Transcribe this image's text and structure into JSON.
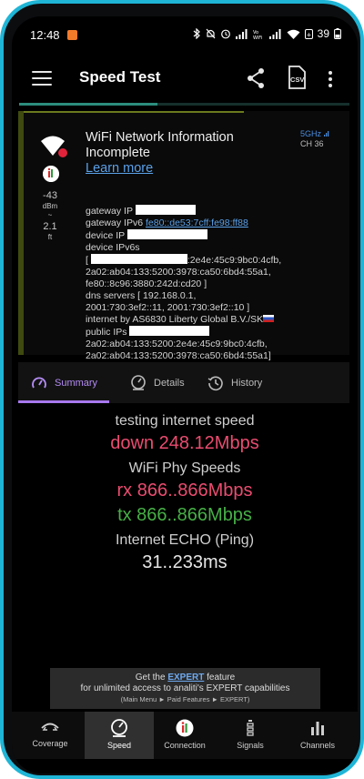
{
  "status_bar": {
    "time": "12:48",
    "battery": "39"
  },
  "app_bar": {
    "title": "Speed Test",
    "csv_label": "CSV"
  },
  "progress": {
    "value_percent": 42
  },
  "network": {
    "title": "WiFi Network Information Incomplete",
    "learn_more": "Learn more",
    "band": "5GHz",
    "channel": "CH 36",
    "rssi": "-43",
    "rssi_unit": "dBm",
    "approx": "~",
    "distance": "2.1",
    "distance_unit": "ft",
    "gateway_ip_label": "gateway IP",
    "gateway_ipv6_label": "gateway IPv6",
    "gateway_ipv6_value": "fe80::de53:7cff:fe98:ff88",
    "device_ip_label": "device IP",
    "device_ipv6s_label": "device IPv6s",
    "ipv6_line1": ":2e4e:45c9:9bc0:4cfb,",
    "ipv6_line2": "2a02:ab04:133:5200:3978:ca50:6bd4:55a1,",
    "ipv6_line3": "fe80::8c96:3880:242d:cd20 ]",
    "dns_line1": "dns servers [ 192.168.0.1,",
    "dns_line2": "2001:730:3ef2::11, 2001:730:3ef2::10 ]",
    "internet_by": "internet by AS6830 Liberty Global B.V./SK",
    "public_ips_label": "public IPs",
    "public_line2": "2a02:ab04:133:5200:2e4e:45c9:9bc0:4cfb,",
    "public_line3": "2a02:ab04:133:5200:3978:ca50:6bd4:55a1]"
  },
  "tabs": [
    {
      "label": "Summary"
    },
    {
      "label": "Details"
    },
    {
      "label": "History"
    }
  ],
  "results": {
    "testing_label": "testing internet speed",
    "down_value": "down 248.12Mbps",
    "phy_label": "WiFi Phy Speeds",
    "rx_value": "rx 866..866Mbps",
    "tx_value": "tx 866..866Mbps",
    "ping_label": "Internet ECHO (Ping)",
    "ping_value": "31..233ms"
  },
  "promo": {
    "line1_prefix": "Get the ",
    "line1_highlight": "EXPERT",
    "line1_suffix": " feature",
    "line2": "for unlimited access to analiti's EXPERT capabilities",
    "line3": "(Main Menu ► Paid Features ► EXPERT)"
  },
  "bottom_nav": [
    {
      "label": "Coverage"
    },
    {
      "label": "Speed"
    },
    {
      "label": "Connection"
    },
    {
      "label": "Signals"
    },
    {
      "label": "Channels"
    }
  ],
  "colors": {
    "accent_purple": "#a777ee",
    "download_red": "#ea4c70",
    "tx_green": "#46b046",
    "link_blue": "#5aa0e8"
  }
}
